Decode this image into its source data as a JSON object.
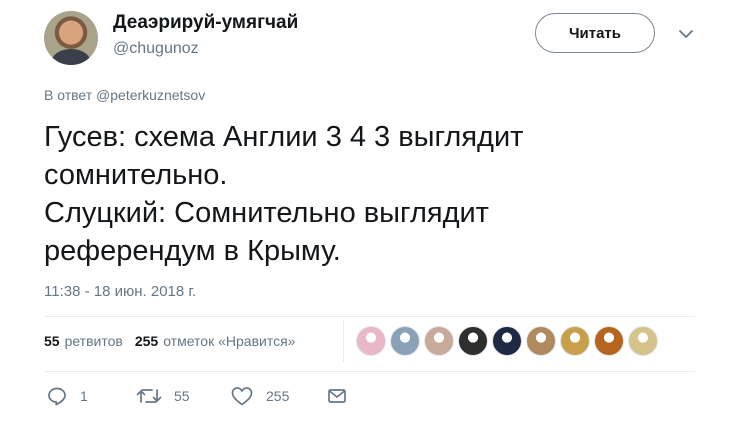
{
  "author": {
    "display_name": "Деаэрируй-умягчай",
    "username": "@chugunoz"
  },
  "follow_button": "Читать",
  "reply_to": {
    "prefix": "В ответ",
    "handle": "@peterkuznetsov"
  },
  "tweet_lines": [
    "Гусев: схема Англии 3 4 3 выглядит",
    "сомнительно.",
    "Слуцкий: Сомнительно выглядит",
    "референдум в Крыму."
  ],
  "timestamp": "11:38 - 18 июн. 2018 г.",
  "stats": {
    "retweets_count": "55",
    "retweets_label": "ретвитов",
    "likes_count": "255",
    "likes_label": "отметок «Нравится»"
  },
  "liker_avatars": [
    {
      "color": "#e8b7c8"
    },
    {
      "color": "#8aa1b8"
    },
    {
      "color": "#c9a99a"
    },
    {
      "color": "#2e2e2e"
    },
    {
      "color": "#1e2a44"
    },
    {
      "color": "#b08a5e"
    },
    {
      "color": "#c8a04a"
    },
    {
      "color": "#b5651d"
    },
    {
      "color": "#d6c38a"
    }
  ],
  "actions": {
    "reply_count": "1",
    "retweet_count": "55",
    "like_count": "255"
  },
  "colors": {
    "secondary_text": "#657786",
    "primary_text": "#14171a",
    "divider": "#e6ecf0"
  },
  "icons": [
    "reply-icon",
    "retweet-icon",
    "like-icon",
    "message-icon",
    "chevron-down-icon"
  ]
}
